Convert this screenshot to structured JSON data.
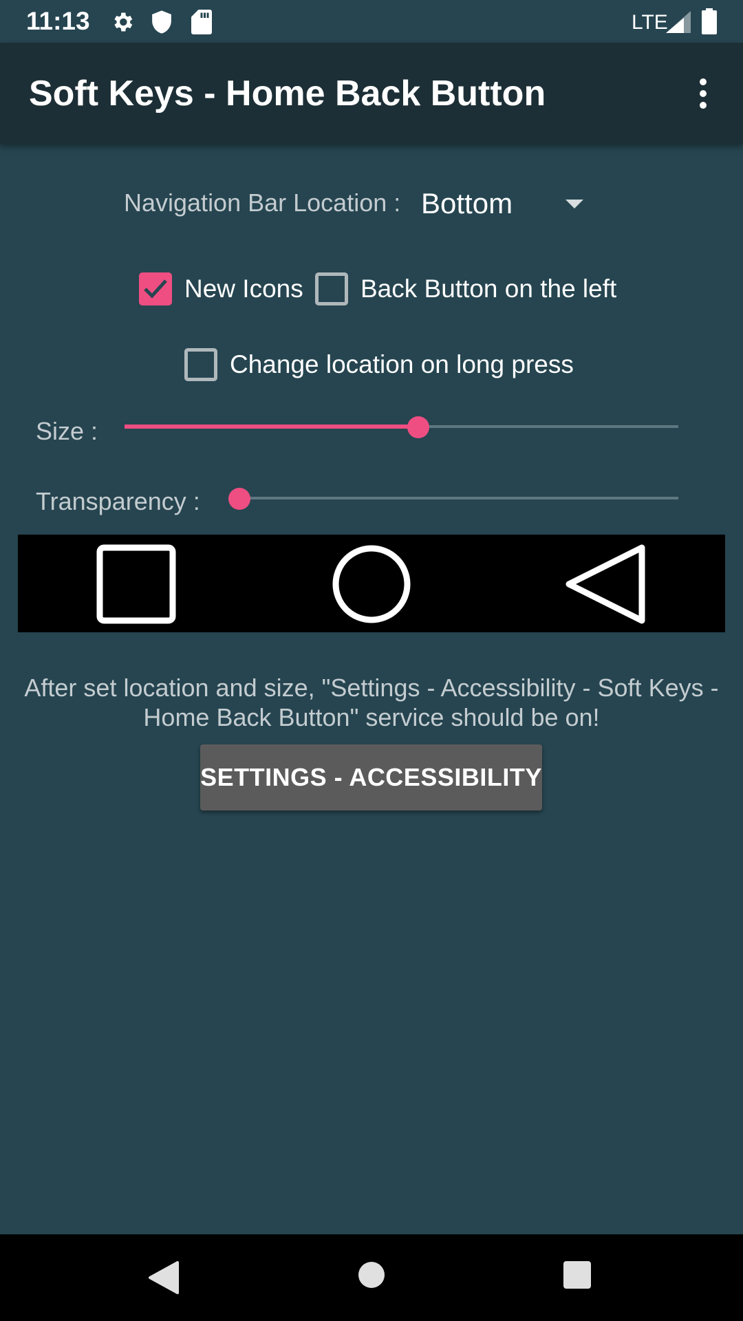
{
  "status_bar": {
    "time": "11:13",
    "network": "LTE",
    "icons": [
      "gear-icon",
      "shield-icon",
      "sd-card-icon",
      "signal-icon",
      "battery-icon"
    ]
  },
  "app_bar": {
    "title": "Soft Keys - Home Back Button",
    "overflow_icon": "more-vert-icon"
  },
  "navigation_location": {
    "label": "Navigation Bar Location :",
    "selected": "Bottom"
  },
  "checkboxes": {
    "new_icons": {
      "label": "New Icons",
      "checked": true
    },
    "back_left": {
      "label": "Back Button on the left",
      "checked": false
    },
    "long_press": {
      "label": "Change location on long press",
      "checked": false
    }
  },
  "sliders": {
    "size": {
      "label": "Size :",
      "value": 0.53
    },
    "transparency": {
      "label": "Transparency :",
      "value": 0.0
    }
  },
  "preview": {
    "icons": [
      "square-recents-icon",
      "circle-home-icon",
      "triangle-back-icon"
    ]
  },
  "info_text": "After set location and size, \"Settings - Accessibility - Soft Keys - Home Back Button\" service should be on!",
  "settings_button": {
    "label": "SETTINGS - ACCESSIBILITY"
  },
  "system_nav": {
    "icons": [
      "back-icon",
      "home-icon",
      "recents-icon"
    ]
  },
  "colors": {
    "background": "#264550",
    "app_bar": "#1d2f36",
    "accent": "#ef4e82",
    "button": "#5b5b5b"
  }
}
